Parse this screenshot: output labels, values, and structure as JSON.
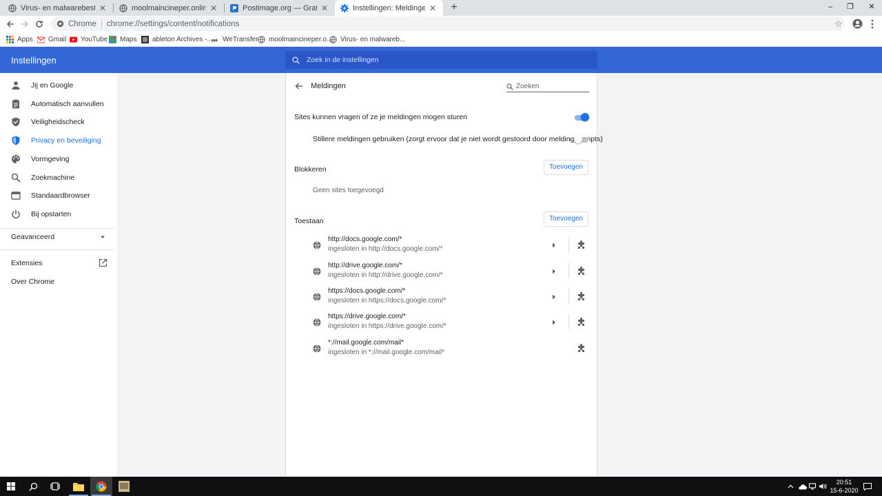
{
  "browser": {
    "tabs": [
      {
        "title": "Virus- en malwarebestrijding log",
        "icon": "globe-icon",
        "active": false
      },
      {
        "title": "moolmaincineper.online komt st",
        "icon": "globe-icon",
        "active": false
      },
      {
        "title": "Postimage.org — Gratis afbeeldi",
        "icon": "postimage-icon",
        "active": false
      },
      {
        "title": "Instellingen: Meldingen",
        "icon": "settings-gear-icon",
        "active": true
      }
    ],
    "new_tab": "+",
    "window_controls": {
      "minimize": "–",
      "restore": "❐",
      "close": "✕"
    },
    "omnibox": {
      "site_label": "Chrome",
      "url": "chrome://settings/content/notifications"
    },
    "bookmarks": [
      {
        "label": "Apps",
        "icon": "apps-grid-icon"
      },
      {
        "label": "Gmail",
        "icon": "gmail-icon"
      },
      {
        "label": "YouTube",
        "icon": "youtube-icon"
      },
      {
        "label": "Maps",
        "icon": "maps-icon"
      },
      {
        "label": "ableton Archives -...",
        "icon": "ableton-icon"
      },
      {
        "label": "WeTransfer",
        "icon": "wetransfer-icon"
      },
      {
        "label": "moolmaincineper.o...",
        "icon": "globe-icon"
      },
      {
        "label": "Virus- en malwareb...",
        "icon": "globe-icon"
      }
    ]
  },
  "settings": {
    "title": "Instellingen",
    "search_placeholder": "Zoek in de instellingen",
    "nav": [
      {
        "label": "Jij en Google",
        "icon": "person-icon",
        "active": false
      },
      {
        "label": "Automatisch aanvullen",
        "icon": "clipboard-icon",
        "active": false
      },
      {
        "label": "Veiligheidscheck",
        "icon": "shield-check-icon",
        "active": false
      },
      {
        "label": "Privacy en beveiliging",
        "icon": "shield-icon",
        "active": true
      },
      {
        "label": "Vormgeving",
        "icon": "palette-icon",
        "active": false
      },
      {
        "label": "Zoekmachine",
        "icon": "search-icon",
        "active": false
      },
      {
        "label": "Standaardbrowser",
        "icon": "browser-window-icon",
        "active": false
      },
      {
        "label": "Bij opstarten",
        "icon": "power-icon",
        "active": false
      }
    ],
    "advanced_label": "Geavanceerd",
    "extensions_label": "Extensies",
    "about_label": "Over Chrome",
    "accent_color": "#1a73e8"
  },
  "notifications": {
    "title": "Meldingen",
    "search_placeholder": "Zoeken",
    "ask_label": "Sites kunnen vragen of ze je meldingen mogen sturen",
    "ask_enabled": true,
    "quiet_label": "Stillere meldingen gebruiken (zorgt ervoor dat je niet wordt gestoord door meldingprompts)",
    "quiet_enabled": false,
    "block": {
      "label": "Blokkeren",
      "add_label": "Toevoegen",
      "empty_message": "Geen sites toegevoegd"
    },
    "allow": {
      "label": "Toestaan",
      "add_label": "Toevoegen",
      "sites": [
        {
          "url": "http://docs.google.com/*",
          "sub": "ingesloten in http://docs.google.com/*",
          "has_arrow": true
        },
        {
          "url": "http://drive.google.com/*",
          "sub": "ingesloten in http://drive.google.com/*",
          "has_arrow": true
        },
        {
          "url": "https://docs.google.com/*",
          "sub": "ingesloten in https://docs.google.com/*",
          "has_arrow": true
        },
        {
          "url": "https://drive.google.com/*",
          "sub": "ingesloten in https://drive.google.com/*",
          "has_arrow": true
        },
        {
          "url": "*://mail.google.com/mail*",
          "sub": "ingesloten in *://mail.google.com/mail*",
          "has_arrow": false
        }
      ]
    }
  },
  "taskbar": {
    "time": "20:51",
    "date": "15-6-2020"
  }
}
